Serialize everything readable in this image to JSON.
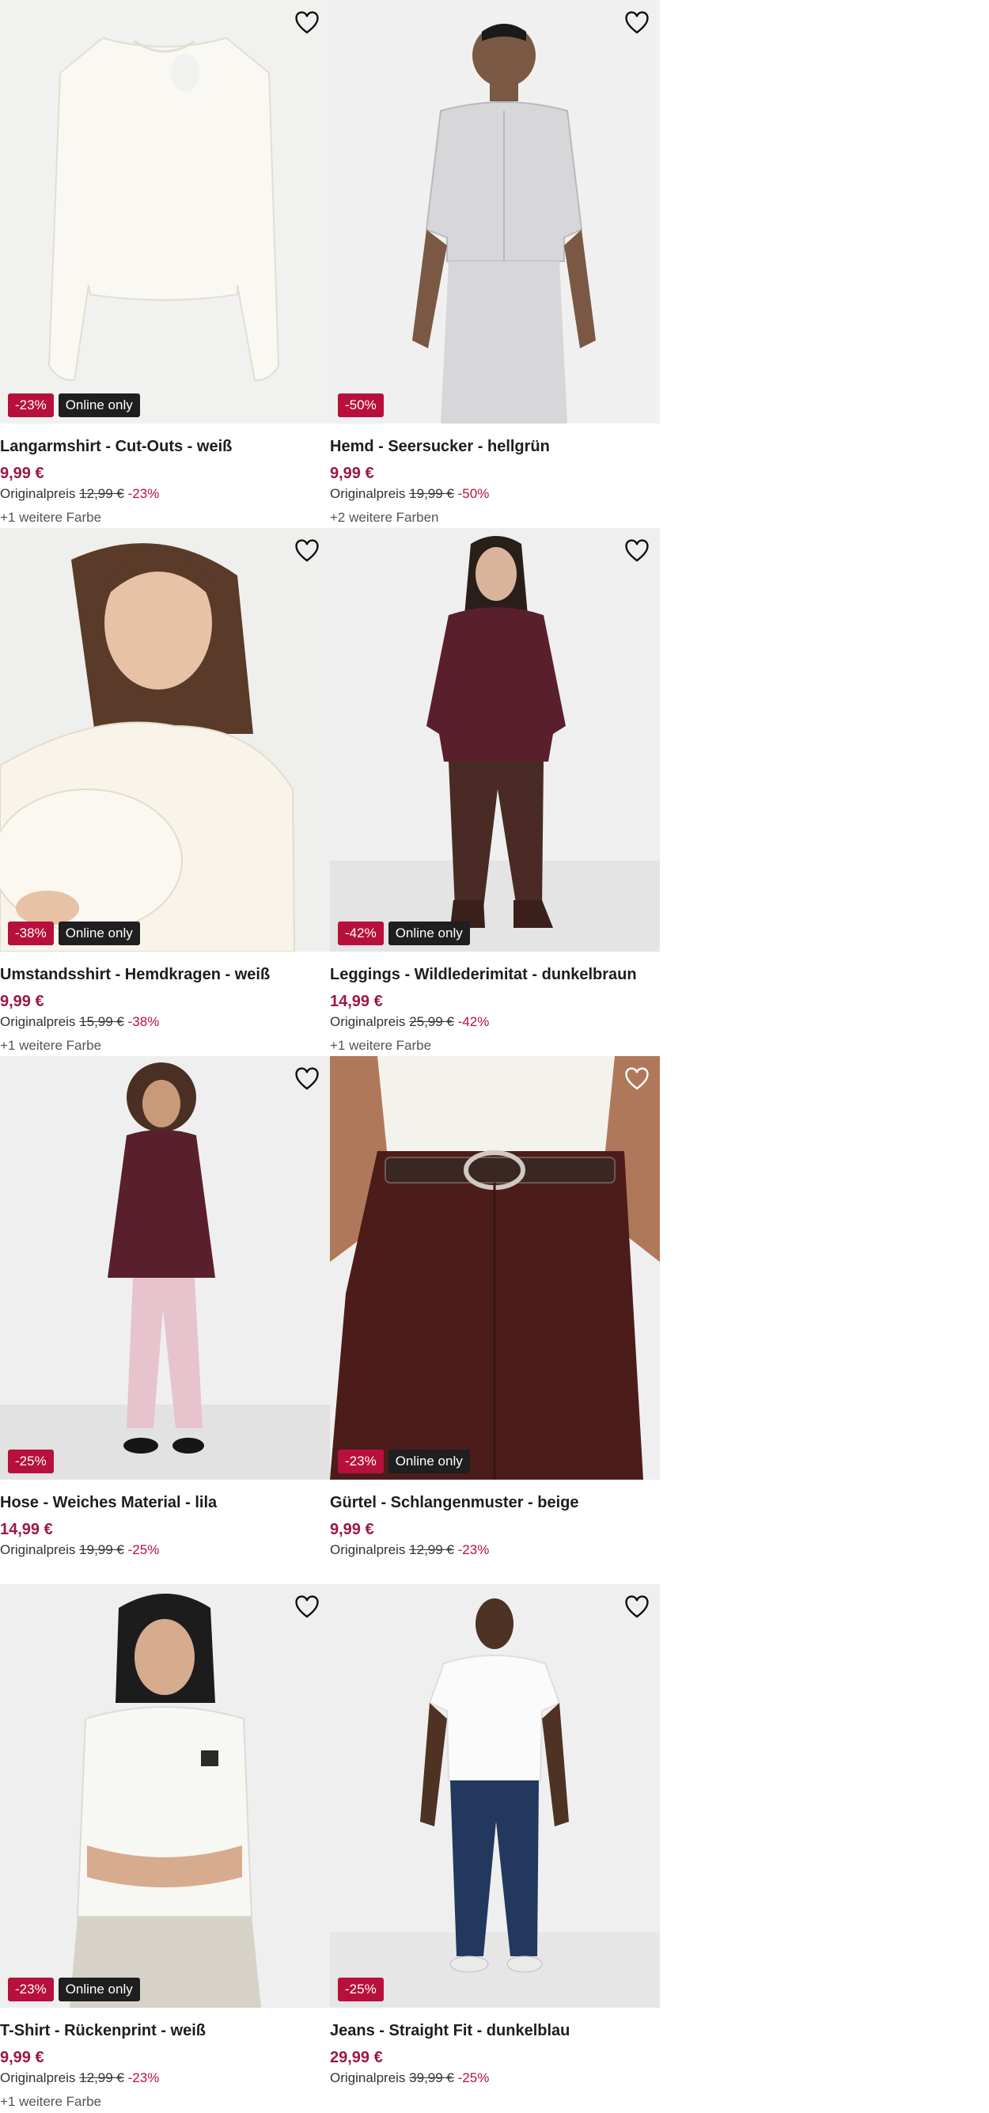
{
  "colors": {
    "discount": "#b8103c",
    "online": "#1f1f1f",
    "price": "#9c1845"
  },
  "labels": {
    "orig_prefix": "Originalpreis"
  },
  "products": [
    {
      "title": "Langarmshirt - Cut-Outs - weiß",
      "price": "9,99 €",
      "orig_price": "12,99 €",
      "discount": "-23%",
      "online_badge": "Online only",
      "discount_badge": "-23%",
      "more_colors": "+1 weitere Farbe",
      "fav_icon": "heart-outline-icon"
    },
    {
      "title": "Hemd - Seersucker - hellgrün",
      "price": "9,99 €",
      "orig_price": "19,99 €",
      "discount": "-50%",
      "online_badge": "",
      "discount_badge": "-50%",
      "more_colors": "+2 weitere Farben",
      "fav_icon": "heart-outline-icon"
    },
    {
      "title": "Umstandsshirt - Hemdkragen - weiß",
      "price": "9,99 €",
      "orig_price": "15,99 €",
      "discount": "-38%",
      "online_badge": "Online only",
      "discount_badge": "-38%",
      "more_colors": "+1 weitere Farbe",
      "fav_icon": "heart-outline-icon"
    },
    {
      "title": "Leggings - Wildlederimitat - dunkelbraun",
      "price": "14,99 €",
      "orig_price": "25,99 €",
      "discount": "-42%",
      "online_badge": "Online only",
      "discount_badge": "-42%",
      "more_colors": "+1 weitere Farbe",
      "fav_icon": "heart-outline-icon"
    },
    {
      "title": "Hose - Weiches Material - lila",
      "price": "14,99 €",
      "orig_price": "19,99 €",
      "discount": "-25%",
      "online_badge": "",
      "discount_badge": "-25%",
      "more_colors": "",
      "fav_icon": "heart-outline-icon"
    },
    {
      "title": "Gürtel - Schlangenmuster - beige",
      "price": "9,99 €",
      "orig_price": "12,99 €",
      "discount": "-23%",
      "online_badge": "Online only",
      "discount_badge": "-23%",
      "more_colors": "",
      "fav_icon": "heart-outline-icon"
    },
    {
      "title": "T-Shirt - Rückenprint - weiß",
      "price": "9,99 €",
      "orig_price": "12,99 €",
      "discount": "-23%",
      "online_badge": "Online only",
      "discount_badge": "-23%",
      "more_colors": "+1 weitere Farbe",
      "fav_icon": "heart-outline-icon"
    },
    {
      "title": "Jeans - Straight Fit - dunkelblau",
      "price": "29,99 €",
      "orig_price": "39,99 €",
      "discount": "-25%",
      "online_badge": "",
      "discount_badge": "-25%",
      "more_colors": "",
      "fav_icon": "heart-outline-icon"
    }
  ]
}
